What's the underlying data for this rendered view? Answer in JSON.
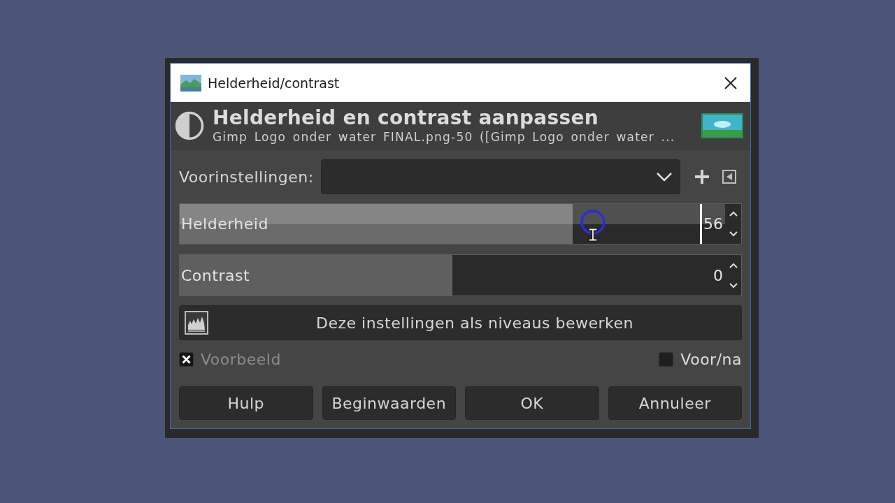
{
  "window": {
    "title": "Helderheid/contrast"
  },
  "header": {
    "title": "Helderheid en contrast aanpassen",
    "subtitle": "Gimp Logo onder water FINAL.png-50 ([Gimp Logo onder water ..."
  },
  "presets": {
    "label": "Voorinstellingen:"
  },
  "sliders": [
    {
      "label": "Helderheid",
      "value": "56",
      "level": 0.72,
      "hovered": true,
      "editing": true
    },
    {
      "label": "Contrast",
      "value": "0",
      "level": 0.5,
      "hovered": false,
      "editing": false
    }
  ],
  "levels_button": {
    "label": "Deze instellingen als niveaus bewerken"
  },
  "options": [
    {
      "label": "Voorbeeld",
      "checked": true,
      "disabled": true
    },
    {
      "label": "Voor/na",
      "checked": false,
      "disabled": false
    }
  ],
  "buttons": [
    "Hulp",
    "Beginwaarden",
    "OK",
    "Annuleer"
  ]
}
